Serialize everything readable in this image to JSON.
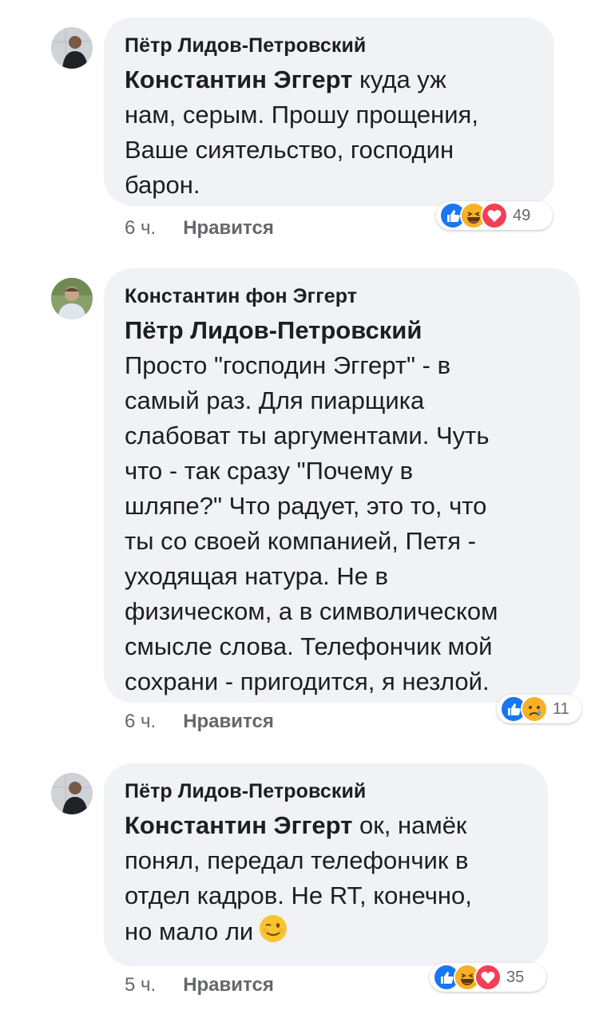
{
  "comments": [
    {
      "author": "Пётр Лидов-Петровский",
      "mention": "Константин Эггерт",
      "text": " куда уж\nнам, серым. Прошу прощения,\nВаше сиятельство, господин\nбарон.",
      "time": "6 ч.",
      "like_label": "Нравится",
      "reactions": [
        "like",
        "haha",
        "love"
      ],
      "reaction_count": "49"
    },
    {
      "author": "Константин фон Эггерт",
      "mention": "Пётр Лидов-Петровский",
      "text": "Просто \"господин Эггерт\" - в\nсамый раз. Для пиарщика\nслабоват ты аргументами. Чуть\nчто - так сразу \"Почему в\nшляпе?\" Что радует, это то, что\nты со своей компанией, Петя -\nуходящая натура. Не в\nфизическом, а в символическом\nсмысле слова. Телефончик мой\nсохрани - пригодится, я незлой.",
      "time": "6 ч.",
      "like_label": "Нравится",
      "reactions": [
        "like",
        "sad"
      ],
      "reaction_count": "11"
    },
    {
      "author": "Пётр Лидов-Петровский",
      "mention": "Константин Эггерт",
      "text": " ок,  намёк\nпонял, передал телефончик в\nотдел кадров. Не RT, конечно,\nно мало ли",
      "inline_emoji": "wink-emoji",
      "time": "5 ч.",
      "like_label": "Нравится",
      "reactions": [
        "like",
        "haha",
        "love"
      ],
      "reaction_count": "35"
    }
  ],
  "colors": {
    "bubble": "#f0f2f5",
    "like": "#1877f2",
    "love": "#f33e58",
    "haha": "#f7b125",
    "meta": "#65676b"
  }
}
